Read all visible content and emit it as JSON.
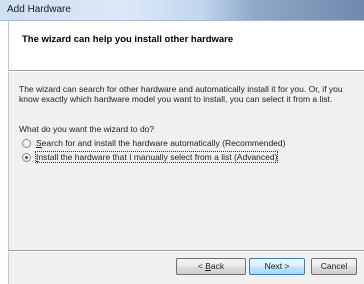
{
  "window": {
    "title": "Add Hardware"
  },
  "header": {
    "title": "The wizard can help you install other hardware"
  },
  "body": {
    "description": "The wizard can search for other hardware and automatically install it for you. Or, if you know exactly which hardware model you want to install, you can select it from a list.",
    "question": "What do you want the wizard to do?",
    "options": [
      {
        "accel": "S",
        "rest": "earch for and install the hardware automatically (Recommended)",
        "selected": false
      },
      {
        "accel": "I",
        "rest": "nstall the hardware that I manually select from a list (Advanced)",
        "selected": true
      }
    ]
  },
  "buttons": {
    "back_prefix": "< ",
    "back_accel": "B",
    "back_rest": "ack",
    "next": "Next >",
    "cancel": "Cancel"
  }
}
